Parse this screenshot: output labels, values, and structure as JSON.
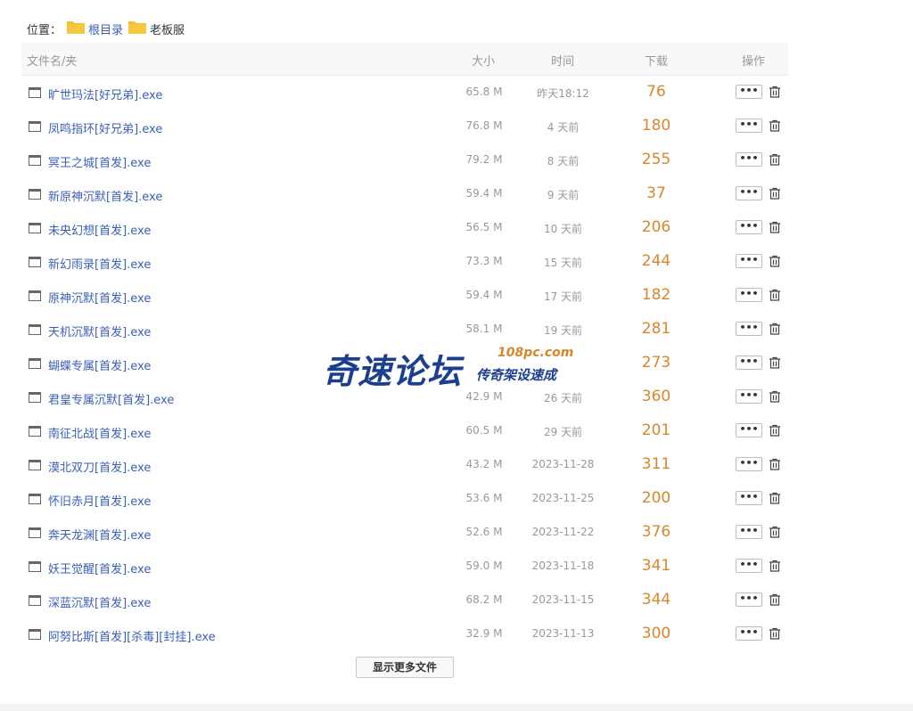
{
  "breadcrumb": {
    "label": "位置：",
    "items": [
      {
        "label": "根目录",
        "icon": "folder-icon"
      },
      {
        "label": "老板服",
        "icon": "folder-icon"
      }
    ]
  },
  "table": {
    "headers": {
      "name": "文件名/夹",
      "size": "大小",
      "time": "时间",
      "downloads": "下载",
      "actions": "操作"
    },
    "more_label": "•••",
    "rows": [
      {
        "name": "旷世玛法[好兄弟].exe",
        "size": "65.8 M",
        "time": "昨天18:12",
        "downloads": "76"
      },
      {
        "name": "凤鸣指环[好兄弟].exe",
        "size": "76.8 M",
        "time": "4 天前",
        "downloads": "180"
      },
      {
        "name": "冥王之城[首发].exe",
        "size": "79.2 M",
        "time": "8 天前",
        "downloads": "255"
      },
      {
        "name": "新原神沉默[首发].exe",
        "size": "59.4 M",
        "time": "9 天前",
        "downloads": "37"
      },
      {
        "name": "未央幻想[首发].exe",
        "size": "56.5 M",
        "time": "10 天前",
        "downloads": "206"
      },
      {
        "name": "新幻雨录[首发].exe",
        "size": "73.3 M",
        "time": "15 天前",
        "downloads": "244"
      },
      {
        "name": "原神沉默[首发].exe",
        "size": "59.4 M",
        "time": "17 天前",
        "downloads": "182"
      },
      {
        "name": "天机沉默[首发].exe",
        "size": "58.1 M",
        "time": "19 天前",
        "downloads": "281"
      },
      {
        "name": "蝴蝶专属[首发].exe",
        "size": "",
        "time": "",
        "downloads": "273"
      },
      {
        "name": "君皇专属沉默[首发].exe",
        "size": "42.9 M",
        "time": "26 天前",
        "downloads": "360"
      },
      {
        "name": "南征北战[首发].exe",
        "size": "60.5 M",
        "time": "29 天前",
        "downloads": "201"
      },
      {
        "name": "漠北双刀[首发].exe",
        "size": "43.2 M",
        "time": "2023-11-28",
        "downloads": "311"
      },
      {
        "name": "怀旧赤月[首发].exe",
        "size": "53.6 M",
        "time": "2023-11-25",
        "downloads": "200"
      },
      {
        "name": "奔天龙渊[首发].exe",
        "size": "52.6 M",
        "time": "2023-11-22",
        "downloads": "376"
      },
      {
        "name": "妖王觉醒[首发].exe",
        "size": "59.0 M",
        "time": "2023-11-18",
        "downloads": "341"
      },
      {
        "name": "深蓝沉默[首发].exe",
        "size": "68.2 M",
        "time": "2023-11-15",
        "downloads": "344"
      },
      {
        "name": "阿努比斯[首发][杀毒][封挂].exe",
        "size": "32.9 M",
        "time": "2023-11-13",
        "downloads": "300"
      }
    ]
  },
  "load_more_label": "显示更多文件",
  "watermark": {
    "main": "奇速论坛",
    "url": "108pc.com",
    "sub": "传奇架设速成"
  },
  "colors": {
    "link": "#3b5fb8",
    "downloads": "#d9862b",
    "folder": "#f2c132"
  }
}
